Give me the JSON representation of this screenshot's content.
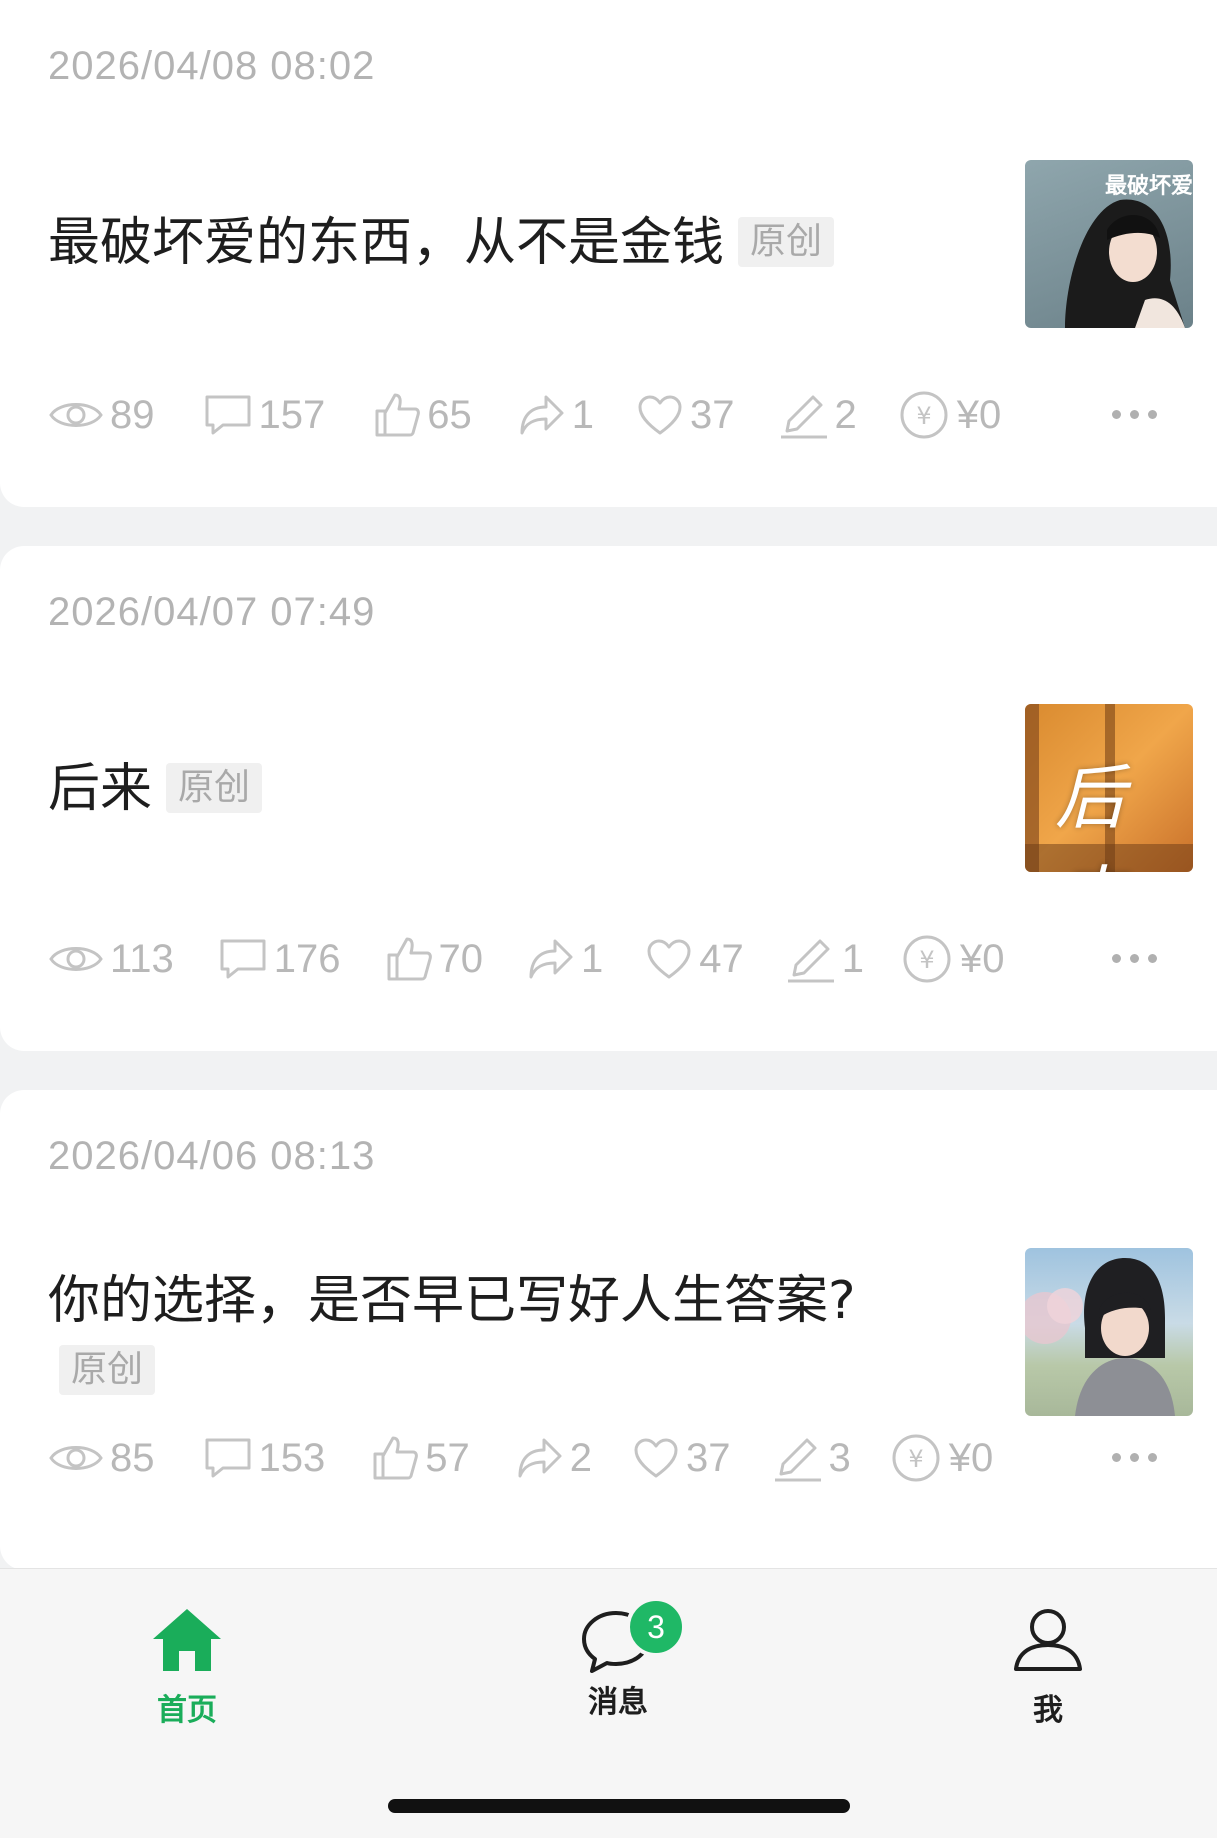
{
  "posts": [
    {
      "date": "2026/04/08 08:02",
      "title": "最破坏爱的东西，从不是金钱",
      "tag": "原创",
      "thumb_text": "最破坏爱",
      "stats": {
        "views": "89",
        "comments": "157",
        "likes": "65",
        "shares": "1",
        "favorites": "37",
        "edits": "2",
        "reward": "¥0"
      }
    },
    {
      "date": "2026/04/07 07:49",
      "title": "后来",
      "tag": "原创",
      "thumb_text": "后来",
      "stats": {
        "views": "113",
        "comments": "176",
        "likes": "70",
        "shares": "1",
        "favorites": "47",
        "edits": "1",
        "reward": "¥0"
      }
    },
    {
      "date": "2026/04/06 08:13",
      "title": "你的选择，是否早已写好人生答案?",
      "tag": "原创",
      "thumb_text": "",
      "stats": {
        "views": "85",
        "comments": "153",
        "likes": "57",
        "shares": "2",
        "favorites": "37",
        "edits": "3",
        "reward": "¥0"
      }
    }
  ],
  "tabbar": {
    "home": "首页",
    "messages": "消息",
    "messages_badge": "3",
    "me": "我"
  },
  "colors": {
    "accent": "#1aad5a",
    "badge": "#1fb866",
    "muted": "#b8b8b8"
  },
  "icons": [
    "eye-icon",
    "comment-icon",
    "thumbs-up-icon",
    "share-icon",
    "heart-icon",
    "pencil-icon",
    "yuan-coin-icon",
    "more-icon",
    "home-icon",
    "chat-icon",
    "person-icon"
  ]
}
